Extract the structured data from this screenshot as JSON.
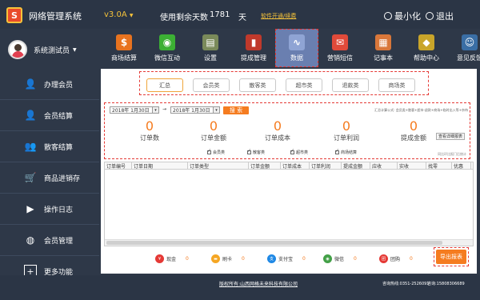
{
  "app": {
    "title": "网络管理系统",
    "logo_letter": "S",
    "version": "v3.0A",
    "version_caret": "▼",
    "days_label": "使用剩余天数",
    "days_value": "1781",
    "days_unit": "天",
    "renew_link": "软件开通/续费",
    "minimize": "最小化",
    "exit": "退出"
  },
  "user": {
    "name": "系统测试员",
    "caret": "▼"
  },
  "modules": [
    {
      "label": "商场结算",
      "icon": "dollar-icon",
      "glyph": "$",
      "color": "#e8731f"
    },
    {
      "label": "微信互动",
      "icon": "wechat-icon",
      "glyph": "◉",
      "color": "#3cb034"
    },
    {
      "label": "设置",
      "icon": "settings-icon",
      "glyph": "▤",
      "color": "#7a8a5a"
    },
    {
      "label": "提成管理",
      "icon": "commission-icon",
      "glyph": "▮",
      "color": "#c0392b"
    },
    {
      "label": "数据",
      "icon": "chart-icon",
      "glyph": "∿",
      "color": "#8fa4d4"
    },
    {
      "label": "营销短信",
      "icon": "sms-icon",
      "glyph": "✉",
      "color": "#e04a3a"
    },
    {
      "label": "记事本",
      "icon": "notebook-icon",
      "glyph": "▦",
      "color": "#d9773a"
    },
    {
      "label": "帮助中心",
      "icon": "help-icon",
      "glyph": "◆",
      "color": "#c9a52a"
    },
    {
      "label": "意见反馈",
      "icon": "feedback-icon",
      "glyph": "☺",
      "color": "#3a6ea5"
    }
  ],
  "sidebar": [
    {
      "label": "办理会员",
      "icon": "user-icon",
      "glyph": "👤"
    },
    {
      "label": "会员结算",
      "icon": "member-checkout-icon",
      "glyph": "👤"
    },
    {
      "label": "散客结算",
      "icon": "guests-icon",
      "glyph": "👥"
    },
    {
      "label": "商品进销存",
      "icon": "cart-icon",
      "glyph": "🛒"
    },
    {
      "label": "操作日志",
      "icon": "log-icon",
      "glyph": "▶"
    },
    {
      "label": "会员管理",
      "icon": "member-manage-icon",
      "glyph": "◍"
    },
    {
      "label": "更多功能",
      "icon": "plus-icon",
      "glyph": "+"
    }
  ],
  "filter_tabs": [
    "汇总",
    "会员类",
    "散客类",
    "超市类",
    "退款类",
    "商场类"
  ],
  "query": {
    "date_from": "2018年 1月30日",
    "date_to": "2018年 1月30日",
    "date_sep": "→",
    "search_label": "搜 索",
    "formula": "汇总计算公式: 会员类+散客+超市-退款+商场+临时出入等+杂待",
    "detail_label": "查看详细报表",
    "compare_note": "同比环比报门后统计",
    "stats": [
      {
        "value": "0",
        "label": "订单数"
      },
      {
        "value": "0",
        "label": "订单金额"
      },
      {
        "value": "0",
        "label": "订单成本"
      },
      {
        "value": "0",
        "label": "订单利润"
      },
      {
        "value": "0",
        "label": "提成金额"
      }
    ],
    "checkboxes": [
      "会员类",
      "散客类",
      "超市类",
      "商场结算"
    ]
  },
  "grid": {
    "columns": [
      "订单编号",
      "订单日期",
      "订单类型",
      "订单金额",
      "订单成本",
      "订单利润",
      "提成金额",
      "应收",
      "实收",
      "找零",
      "优惠"
    ]
  },
  "payments": [
    {
      "label": "现金",
      "value": "0",
      "icon": "cash-icon",
      "color": "#e53935",
      "glyph": "¥"
    },
    {
      "label": "刷卡",
      "value": "0",
      "icon": "card-icon",
      "color": "#f5a623",
      "glyph": "▬"
    },
    {
      "label": "支付宝",
      "value": "0",
      "icon": "alipay-icon",
      "color": "#1e88e5",
      "glyph": "支"
    },
    {
      "label": "微信",
      "value": "0",
      "icon": "wechat-pay-icon",
      "color": "#43a047",
      "glyph": "◉"
    },
    {
      "label": "团购",
      "value": "0",
      "icon": "groupbuy-icon",
      "color": "#e53935",
      "glyph": "团"
    }
  ],
  "export_label": "导出报表",
  "footer": {
    "copyright": "版权所有:山西网格未来科技有限公司",
    "hotline": "咨询热线:0351-2526091",
    "mobile": "咨询:15808306689"
  }
}
